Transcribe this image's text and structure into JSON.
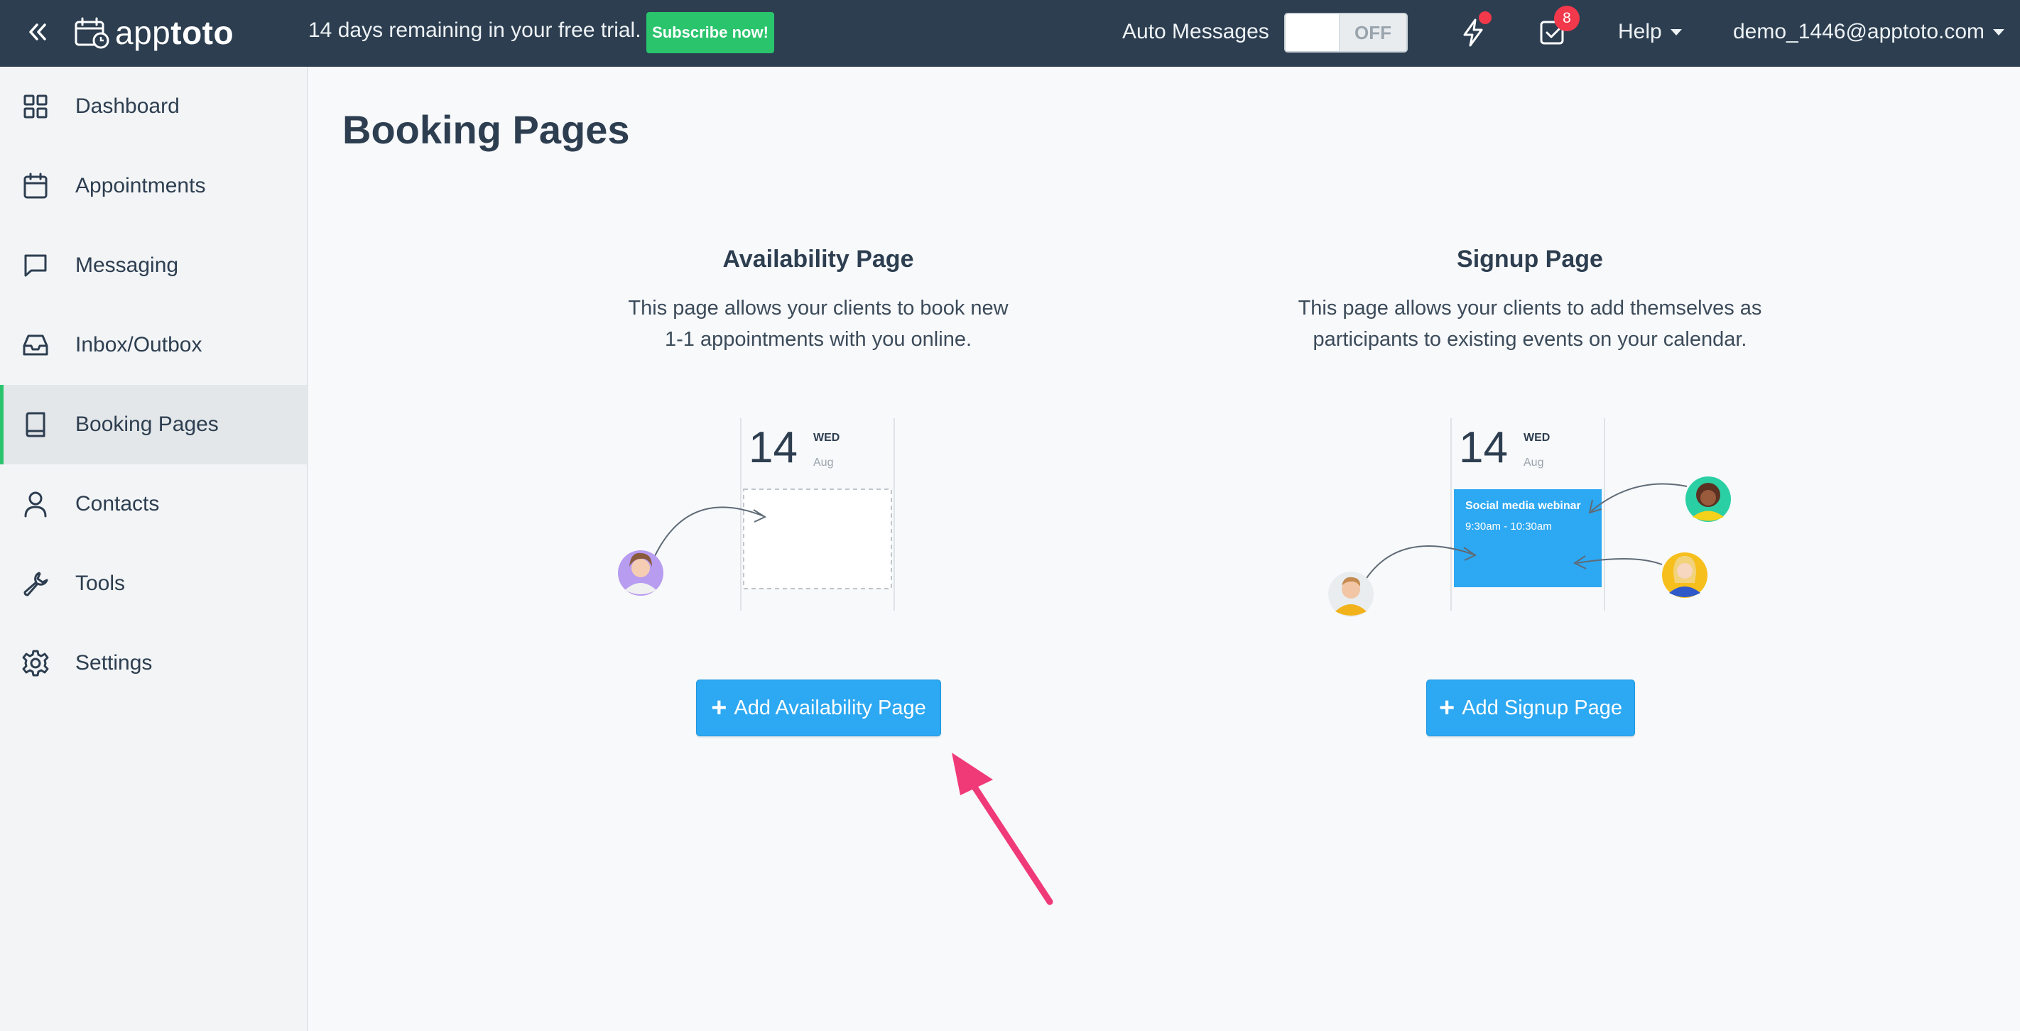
{
  "header": {
    "logo_light": "app",
    "logo_bold": "toto",
    "trial_text": "14 days remaining in your free trial.",
    "subscribe_label": "Subscribe now!",
    "auto_messages_label": "Auto Messages",
    "toggle_state": "OFF",
    "tasks_badge": "8",
    "help_label": "Help",
    "user_email": "demo_1446@apptoto.com"
  },
  "sidebar": {
    "items": [
      {
        "label": "Dashboard",
        "icon": "grid-icon"
      },
      {
        "label": "Appointments",
        "icon": "calendar-icon"
      },
      {
        "label": "Messaging",
        "icon": "chat-icon"
      },
      {
        "label": "Inbox/Outbox",
        "icon": "inbox-icon"
      },
      {
        "label": "Booking Pages",
        "icon": "book-icon",
        "active": true
      },
      {
        "label": "Contacts",
        "icon": "person-icon"
      },
      {
        "label": "Tools",
        "icon": "wrench-icon"
      },
      {
        "label": "Settings",
        "icon": "gear-icon"
      }
    ]
  },
  "main": {
    "title": "Booking Pages",
    "availability": {
      "title": "Availability Page",
      "desc_line1": "This page allows your clients to book new",
      "desc_line2": "1-1 appointments with you online.",
      "cal_day": "14",
      "cal_weekday": "WED",
      "cal_month": "Aug",
      "button_label": "Add Availability Page"
    },
    "signup": {
      "title": "Signup Page",
      "desc_line1": "This page allows your clients to add themselves as",
      "desc_line2": "participants to existing events on your calendar.",
      "cal_day": "14",
      "cal_weekday": "WED",
      "cal_month": "Aug",
      "event_title": "Social media webinar",
      "event_time": "9:30am - 10:30am",
      "button_label": "Add Signup Page"
    }
  },
  "colors": {
    "topbar": "#2c3e50",
    "accent_green": "#2ac46d",
    "button_blue": "#2da8f2",
    "badge_red": "#f1394b",
    "annotation_arrow": "#f03a78"
  }
}
